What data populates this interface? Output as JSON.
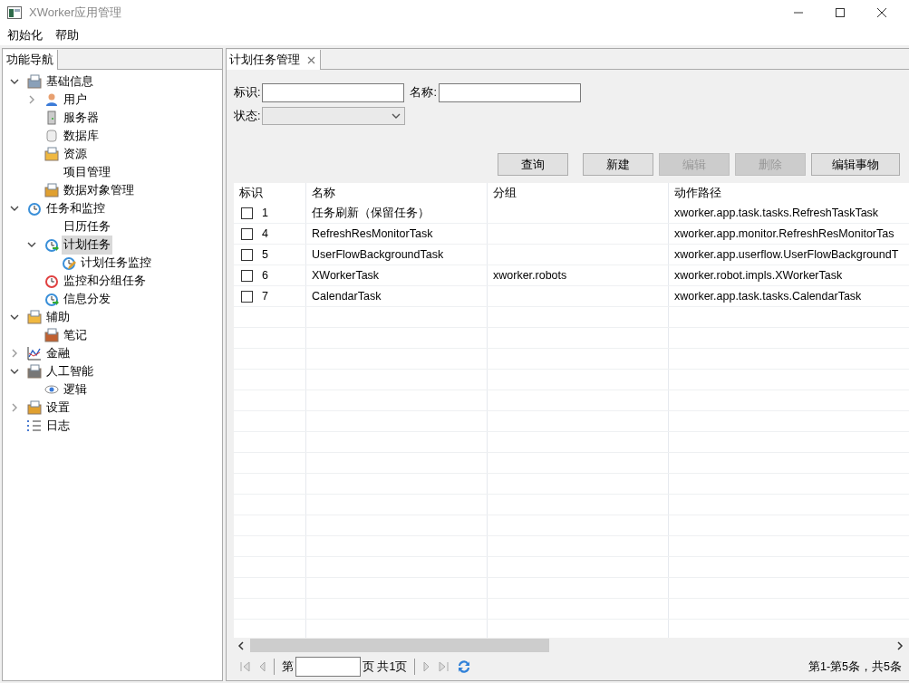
{
  "window": {
    "title": "XWorker应用管理"
  },
  "menu": [
    "初始化",
    "帮助"
  ],
  "sidebar": {
    "tab": "功能导航",
    "tree": [
      {
        "label": "基础信息",
        "kind": "basket",
        "expanded": true,
        "selected": false,
        "children": [
          {
            "label": "用户",
            "kind": "user",
            "expanded": false,
            "selected": false
          },
          {
            "label": "服务器",
            "kind": "server",
            "selected": false
          },
          {
            "label": "数据库",
            "kind": "database",
            "selected": false
          },
          {
            "label": "资源",
            "kind": "folder",
            "selected": false
          },
          {
            "label": "项目管理",
            "kind": "none",
            "selected": false
          },
          {
            "label": "数据对象管理",
            "kind": "edit",
            "selected": false
          }
        ]
      },
      {
        "label": "任务和监控",
        "kind": "clock",
        "expanded": true,
        "selected": false,
        "children": [
          {
            "label": "日历任务",
            "kind": "none",
            "selected": false
          },
          {
            "label": "计划任务",
            "kind": "clock-go",
            "expanded": true,
            "selected": true,
            "children": [
              {
                "label": "计划任务监控",
                "kind": "clock-edit",
                "selected": false
              }
            ]
          },
          {
            "label": "监控和分组任务",
            "kind": "clock-red",
            "selected": false
          },
          {
            "label": "信息分发",
            "kind": "clock-go",
            "selected": false
          }
        ]
      },
      {
        "label": "辅助",
        "kind": "folder-user",
        "expanded": true,
        "selected": false,
        "children": [
          {
            "label": "笔记",
            "kind": "note",
            "selected": false
          }
        ]
      },
      {
        "label": "金融",
        "kind": "chart",
        "expanded": false,
        "selected": false
      },
      {
        "label": "人工智能",
        "kind": "webcam",
        "expanded": true,
        "selected": false,
        "children": [
          {
            "label": "逻辑",
            "kind": "eye",
            "selected": false
          }
        ]
      },
      {
        "label": "设置",
        "kind": "edit",
        "expanded": false,
        "selected": false
      },
      {
        "label": "日志",
        "kind": "list",
        "selected": false
      }
    ]
  },
  "editor_tab": {
    "title": "计划任务管理"
  },
  "filters": {
    "id_label": "标识:",
    "name_label": "名称:",
    "status_label": "状态:"
  },
  "buttons": [
    {
      "label": "查询",
      "disabled": false
    },
    {
      "label": "新建",
      "disabled": false
    },
    {
      "label": "编辑",
      "disabled": true
    },
    {
      "label": "删除",
      "disabled": true
    },
    {
      "label": "编辑事物",
      "disabled": false
    }
  ],
  "table": {
    "columns": [
      "标识",
      "名称",
      "分组",
      "动作路径"
    ],
    "rows": [
      {
        "checked": false,
        "id": "1",
        "name": "任务刷新（保留任务）",
        "group": "",
        "path": "xworker.app.task.tasks.RefreshTaskTask"
      },
      {
        "checked": false,
        "id": "4",
        "name": "RefreshResMonitorTask",
        "group": "",
        "path": "xworker.app.monitor.RefreshResMonitorTas"
      },
      {
        "checked": false,
        "id": "5",
        "name": "UserFlowBackgroundTask",
        "group": "",
        "path": "xworker.app.userflow.UserFlowBackgroundT"
      },
      {
        "checked": false,
        "id": "6",
        "name": "XWorkerTask",
        "group": "xworker.robots",
        "path": "xworker.robot.impls.XWorkerTask"
      },
      {
        "checked": false,
        "id": "7",
        "name": "CalendarTask",
        "group": "",
        "path": "xworker.app.task.tasks.CalendarTask"
      }
    ]
  },
  "pager": {
    "prefix": "第",
    "suffix": "页 共1页",
    "summary": "第1-第5条，共5条"
  }
}
